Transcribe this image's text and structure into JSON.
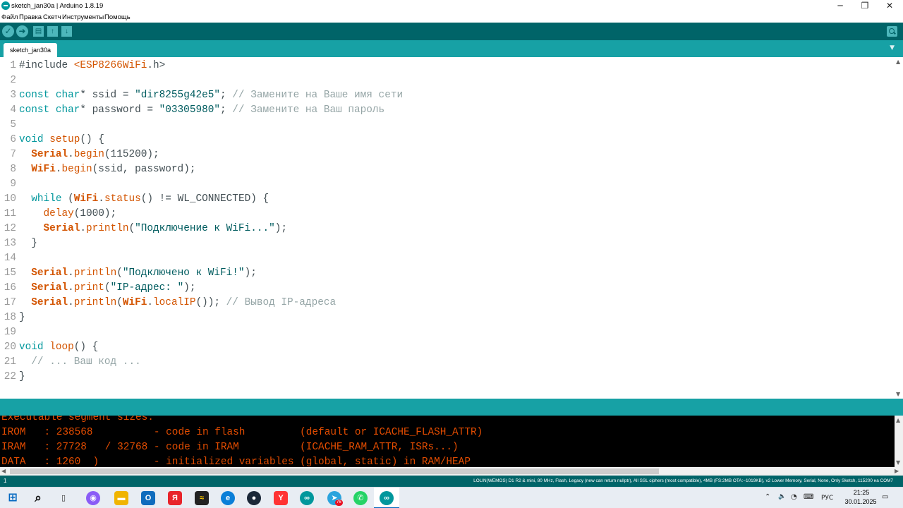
{
  "window": {
    "title": "sketch_jan30a | Arduino 1.8.19",
    "controls": {
      "minimize": "─",
      "restore": "❐",
      "close": "✕"
    }
  },
  "menu": [
    "Файл",
    "Правка",
    "Скетч",
    "Инструменты",
    "Помощь"
  ],
  "toolbar": {
    "verify_icon": "check-icon",
    "upload_icon": "arrow-right-icon",
    "new_icon": "file-icon",
    "open_icon": "arrow-up-icon",
    "save_icon": "arrow-down-icon",
    "serial_monitor_icon": "magnifier-icon"
  },
  "tabs": {
    "active": "sketch_jan30a",
    "menu_glyph": "▼"
  },
  "editor": {
    "lines": [
      {
        "n": "1",
        "html": "#include <span class='fn'>&lt;ESP8266WiFi</span>.h&gt;"
      },
      {
        "n": "2",
        "html": ""
      },
      {
        "n": "3",
        "html": "<span class='kw'>const</span> <span class='kw'>char</span>* ssid = <span class='str'>\"dir8255g42e5\"</span>; <span class='cm'>// Замените на Ваше имя сети</span>"
      },
      {
        "n": "4",
        "html": "<span class='kw'>const</span> <span class='kw'>char</span>* password = <span class='str'>\"03305980\"</span>; <span class='cm'>// Замените на Ваш пароль</span>"
      },
      {
        "n": "5",
        "html": ""
      },
      {
        "n": "6",
        "html": "<span class='kw'>void</span> <span class='fn'>setup</span>() {"
      },
      {
        "n": "7",
        "html": "  <span class='cls'>Serial</span>.<span class='fn'>begin</span>(115200);"
      },
      {
        "n": "8",
        "html": "  <span class='cls'>WiFi</span>.<span class='fn'>begin</span>(ssid, password);"
      },
      {
        "n": "9",
        "html": ""
      },
      {
        "n": "10",
        "html": "  <span class='kw'>while</span> (<span class='cls'>WiFi</span>.<span class='fn'>status</span>() != WL_CONNECTED) {"
      },
      {
        "n": "11",
        "html": "    <span class='fn'>delay</span>(1000);"
      },
      {
        "n": "12",
        "html": "    <span class='cls'>Serial</span>.<span class='fn'>println</span>(<span class='str'>\"Подключение к WiFi...\"</span>);"
      },
      {
        "n": "13",
        "html": "  }"
      },
      {
        "n": "14",
        "html": ""
      },
      {
        "n": "15",
        "html": "  <span class='cls'>Serial</span>.<span class='fn'>println</span>(<span class='str'>\"Подключено к WiFi!\"</span>);"
      },
      {
        "n": "16",
        "html": "  <span class='cls'>Serial</span>.<span class='fn'>print</span>(<span class='str'>\"IP-адрес: \"</span>);"
      },
      {
        "n": "17",
        "html": "  <span class='cls'>Serial</span>.<span class='fn'>println</span>(<span class='cls'>WiFi</span>.<span class='fn'>localIP</span>()); <span class='cm'>// Вывод IP-адреса</span>"
      },
      {
        "n": "18",
        "html": "}"
      },
      {
        "n": "19",
        "html": ""
      },
      {
        "n": "20",
        "html": "<span class='kw'>void</span> <span class='fn'>loop</span>() {"
      },
      {
        "n": "21",
        "html": "  <span class='cm'>// ... Ваш код ...</span>"
      },
      {
        "n": "22",
        "html": "}"
      }
    ]
  },
  "console": {
    "lines": [
      "Executable segment sizes:",
      "IROM   : 238568          - code in flash         (default or ICACHE_FLASH_ATTR)",
      "IRAM   : 27728   / 32768 - code in IRAM          (ICACHE_RAM_ATTR, ISRs...)",
      "DATA   : 1260  )         - initialized variables (global, static) in RAM/HEAP"
    ]
  },
  "status": {
    "line": "1",
    "board": "LOLIN(WEMOS) D1 R2 & mini, 80 MHz, Flash, Legacy (new can return nullptr), All SSL ciphers (most compatible), 4MB (FS:2MB OTA:~1019KB), v2 Lower Memory, Serial, None, Only Sketch, 115200 на COM7"
  },
  "taskbar": {
    "apps": [
      {
        "name": "start-icon",
        "glyph": "⊞"
      },
      {
        "name": "search-icon",
        "glyph": "⌕"
      },
      {
        "name": "task-view-icon",
        "glyph": "▯"
      },
      {
        "name": "alice-icon",
        "glyph": "◉"
      },
      {
        "name": "file-explorer-icon",
        "glyph": "▬"
      },
      {
        "name": "outlook-icon",
        "glyph": "O"
      },
      {
        "name": "yandex-icon",
        "glyph": "Я"
      },
      {
        "name": "app-icon",
        "glyph": "≈"
      },
      {
        "name": "edge-icon",
        "glyph": "e"
      },
      {
        "name": "steam-icon",
        "glyph": "●"
      },
      {
        "name": "yandex-browser-icon",
        "glyph": "Y"
      },
      {
        "name": "arduino-icon",
        "glyph": "∞"
      },
      {
        "name": "telegram-icon",
        "glyph": "➤"
      },
      {
        "name": "whatsapp-icon",
        "glyph": "✆"
      },
      {
        "name": "arduino-active-icon",
        "glyph": "∞"
      }
    ],
    "telegram_badge": "76",
    "tray": {
      "chevron": "⌃",
      "volume": "🔈",
      "language": "РУС"
    },
    "time": "21:25",
    "date": "30.01.2025"
  }
}
